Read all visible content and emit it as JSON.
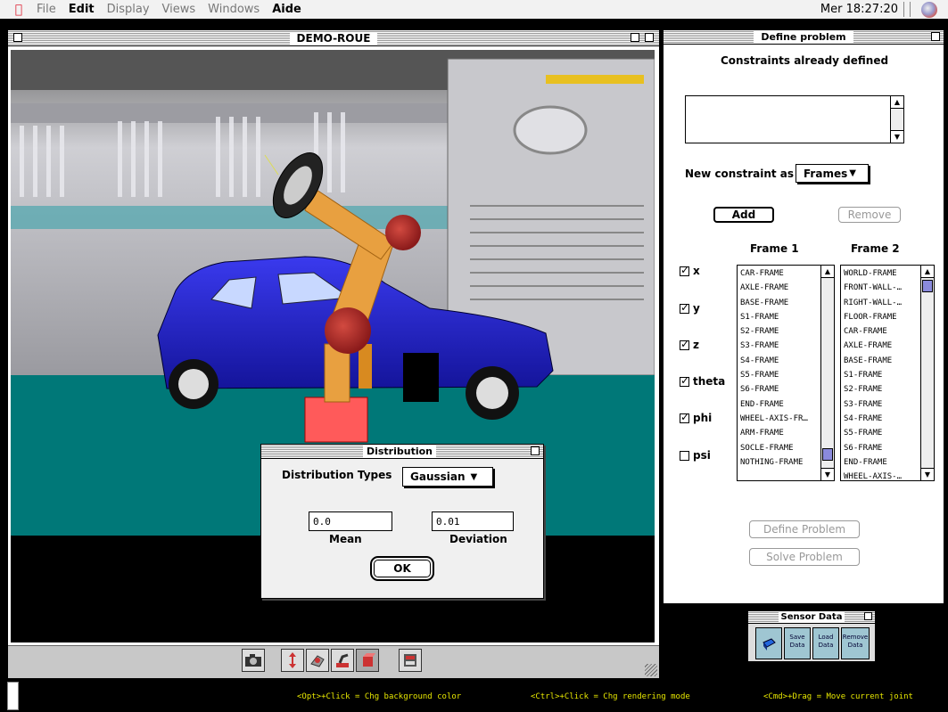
{
  "menubar": {
    "items": [
      {
        "label": "File",
        "active": false
      },
      {
        "label": "Edit",
        "active": true
      },
      {
        "label": "Display",
        "active": false
      },
      {
        "label": "Views",
        "active": false
      },
      {
        "label": "Windows",
        "active": false
      },
      {
        "label": "Aide",
        "active": true
      }
    ],
    "clock": "Mer 18:27:20"
  },
  "viewer": {
    "title": "DEMO-ROUE",
    "tools": [
      "camera-icon",
      "move-icon",
      "rotate-icon",
      "robot-arm-icon",
      "object-icon",
      "panel-icon"
    ]
  },
  "distribution": {
    "title": "Distribution",
    "types_label": "Distribution Types",
    "type_selected": "Gaussian",
    "mean_value": "0.0",
    "mean_label": "Mean",
    "deviation_value": "0.01",
    "deviation_label": "Deviation",
    "ok_label": "OK"
  },
  "define_problem": {
    "title": "Define problem",
    "constraints_heading": "Constraints already defined",
    "new_constraint_label": "New constraint as",
    "new_constraint_value": "Frames",
    "add_label": "Add",
    "remove_label": "Remove",
    "frame1_heading": "Frame 1",
    "frame2_heading": "Frame 2",
    "checks": [
      {
        "label": "x",
        "checked": true
      },
      {
        "label": "y",
        "checked": true
      },
      {
        "label": "z",
        "checked": true
      },
      {
        "label": "theta",
        "checked": true
      },
      {
        "label": "phi",
        "checked": true
      },
      {
        "label": "psi",
        "checked": false
      }
    ],
    "frame1_items": [
      "CAR-FRAME",
      "AXLE-FRAME",
      "BASE-FRAME",
      "S1-FRAME",
      "S2-FRAME",
      "S3-FRAME",
      "S4-FRAME",
      "S5-FRAME",
      "S6-FRAME",
      "END-FRAME",
      "WHEEL-AXIS-FR…",
      "ARM-FRAME",
      "SOCLE-FRAME",
      "NOTHING-FRAME"
    ],
    "frame2_items": [
      "WORLD-FRAME",
      "FRONT-WALL-…",
      "RIGHT-WALL-…",
      "FLOOR-FRAME",
      "CAR-FRAME",
      "AXLE-FRAME",
      "BASE-FRAME",
      "S1-FRAME",
      "S2-FRAME",
      "S3-FRAME",
      "S4-FRAME",
      "S5-FRAME",
      "S6-FRAME",
      "END-FRAME",
      "WHEEL-AXIS-…"
    ],
    "define_label": "Define Problem",
    "solve_label": "Solve Problem"
  },
  "sensor": {
    "title": "Sensor Data",
    "buttons": [
      "Save Data",
      "Load Data",
      "Remove Data"
    ]
  },
  "status": {
    "hint1": "<Opt>+Click = Chg background color",
    "hint2": "<Ctrl>+Click = Chg rendering mode",
    "hint3": "<Cmd>+Drag = Move current joint"
  },
  "colors": {
    "car": "#2222cc",
    "robot": "#e8a040",
    "joint": "#c03030",
    "floor": "#007878",
    "status_text": "#e6e600"
  }
}
